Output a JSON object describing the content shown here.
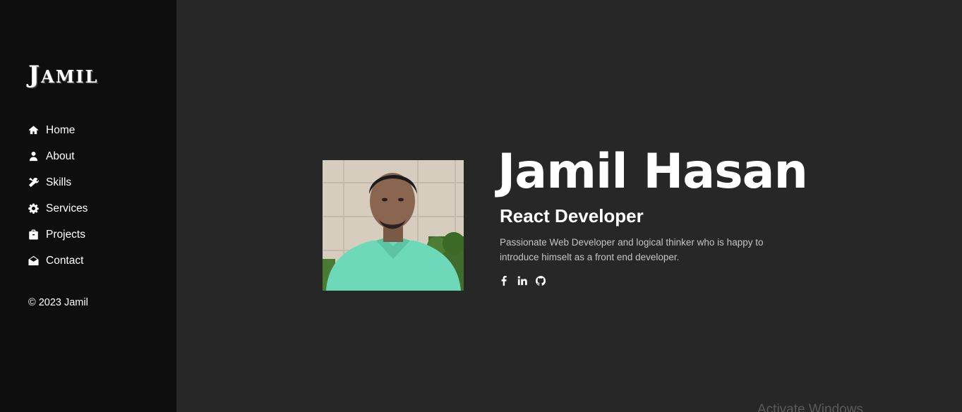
{
  "sidebar": {
    "logo": "Jamil",
    "nav": [
      {
        "label": "Home",
        "icon": "home-icon"
      },
      {
        "label": "About",
        "icon": "user-icon"
      },
      {
        "label": "Skills",
        "icon": "tools-icon"
      },
      {
        "label": "Services",
        "icon": "gear-icon"
      },
      {
        "label": "Projects",
        "icon": "briefcase-icon"
      },
      {
        "label": "Contact",
        "icon": "envelope-open-icon"
      }
    ],
    "copyright": "© 2023 Jamil"
  },
  "hero": {
    "name": "Jamil Hasan",
    "role": "React Developer",
    "description": "Passionate Web Developer and logical thinker who is happy to introduce himselt as a front end developer.",
    "social": [
      {
        "icon": "facebook-icon"
      },
      {
        "icon": "linkedin-icon"
      },
      {
        "icon": "github-icon"
      }
    ]
  },
  "watermark": "Activate Windows",
  "colors": {
    "sidebar_bg": "#0e0e0e",
    "main_bg": "#272727",
    "text": "#ffffff",
    "muted_text": "#c4c4c4"
  }
}
